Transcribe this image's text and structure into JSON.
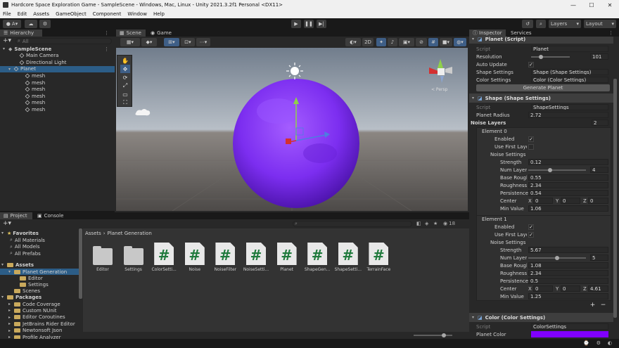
{
  "window": {
    "title": "Hardcore Space Exploration Game - SampleScene - Windows, Mac, Linux - Unity 2021.3.2f1 Personal <DX11>"
  },
  "menu": [
    "File",
    "Edit",
    "Assets",
    "GameObject",
    "Component",
    "Window",
    "Help"
  ],
  "toolbar": {
    "account": "A",
    "layers": "Layers",
    "layout": "Layout"
  },
  "hierarchy": {
    "tab": "Hierarchy",
    "search_placeholder": "All",
    "items": [
      {
        "label": "SampleScene",
        "indent": 0
      },
      {
        "label": "Main Camera",
        "indent": 2
      },
      {
        "label": "Directional Light",
        "indent": 2
      },
      {
        "label": "Planet",
        "indent": 1
      },
      {
        "label": "mesh",
        "indent": 3
      },
      {
        "label": "mesh",
        "indent": 3
      },
      {
        "label": "mesh",
        "indent": 3
      },
      {
        "label": "mesh",
        "indent": 3
      },
      {
        "label": "mesh",
        "indent": 3
      },
      {
        "label": "mesh",
        "indent": 3
      }
    ]
  },
  "scene": {
    "tab_scene": "Scene",
    "tab_game": "Game",
    "mode_2d": "2D",
    "gizmo_label": "< Persp",
    "tool_icons": [
      "hand-icon",
      "move-icon",
      "rotate-icon",
      "scale-icon",
      "rect-icon",
      "transform-icon"
    ]
  },
  "project": {
    "tab_project": "Project",
    "tab_console": "Console",
    "hidden_count": "18",
    "breadcrumb": [
      "Assets",
      "Planet Generation"
    ],
    "favorites_title": "Favorites",
    "favorites": [
      "All Materials",
      "All Models",
      "All Prefabs"
    ],
    "assets_title": "Assets",
    "assets_tree": [
      {
        "label": "Planet Generation",
        "indent": 1
      },
      {
        "label": "Editor",
        "indent": 2
      },
      {
        "label": "Settings",
        "indent": 2
      },
      {
        "label": "Scenes",
        "indent": 1
      }
    ],
    "packages_title": "Packages",
    "packages": [
      "Code Coverage",
      "Custom NUnit",
      "Editor Coroutines",
      "JetBrains Rider Editor",
      "Newtonsoft Json",
      "Profile Analyzer"
    ],
    "files": [
      {
        "name": "Editor",
        "type": "folder"
      },
      {
        "name": "Settings",
        "type": "folder"
      },
      {
        "name": "ColorSetti...",
        "type": "cs"
      },
      {
        "name": "Noise",
        "type": "cs"
      },
      {
        "name": "NoiseFilter",
        "type": "cs"
      },
      {
        "name": "NoiseSetti...",
        "type": "cs"
      },
      {
        "name": "Planet",
        "type": "cs"
      },
      {
        "name": "ShapeGen...",
        "type": "cs"
      },
      {
        "name": "ShapeSetti...",
        "type": "cs"
      },
      {
        "name": "TerrainFace",
        "type": "cs"
      }
    ]
  },
  "inspector": {
    "tab_inspector": "Inspector",
    "tab_services": "Services",
    "planet_script_title": "Planet (Script)",
    "script_label": "Script",
    "script_value": "Planet",
    "resolution_label": "Resolution",
    "resolution_value": "101",
    "resolution_fraction": 0.25,
    "auto_update_label": "Auto Update",
    "shape_settings_label": "Shape Settings",
    "shape_settings_value": "Shape (Shape Settings)",
    "color_settings_label": "Color Settings",
    "color_settings_value": "Color (Color Settings)",
    "generate_button": "Generate Planet",
    "shape_title": "Shape (Shape Settings)",
    "shape_script_value": "ShapeSettings",
    "planet_radius_label": "Planet Radius",
    "planet_radius_value": "2.72",
    "noise_layers_label": "Noise Layers",
    "noise_layers_value": "2",
    "enabled_label": "Enabled",
    "use_first_label": "Use First Layer",
    "noise_settings_label": "Noise Settings",
    "strength_label": "Strength",
    "num_layers_label": "Num Layers",
    "base_rough_label": "Base Roughness",
    "roughness_label": "Roughness",
    "persistence_label": "Persistence",
    "center_label": "Center",
    "min_value_label": "Min Value",
    "x": "X",
    "y": "Y",
    "z": "Z",
    "elements": [
      {
        "title": "Element 0",
        "enabled": true,
        "use_first": false,
        "strength": "0.12",
        "num_layers": "4",
        "num_layers_fraction": 0.38,
        "base_rough": "0.55",
        "roughness": "2.34",
        "persistence": "0.54",
        "cx": "0",
        "cy": "0",
        "cz": "0",
        "min_value": "1.06"
      },
      {
        "title": "Element 1",
        "enabled": true,
        "use_first": true,
        "strength": "5.67",
        "num_layers": "5",
        "num_layers_fraction": 0.5,
        "base_rough": "1.08",
        "roughness": "2.34",
        "persistence": "0.5",
        "cx": "0",
        "cy": "0",
        "cz": "4.61",
        "min_value": "1.25"
      }
    ],
    "color_title": "Color (Color Settings)",
    "color_script_value": "ColorSettings",
    "planet_color_label": "Planet Color",
    "planet_color": "#8000ff"
  },
  "colors": {
    "accent": "#2c5d87",
    "planet": "#8a35f0"
  }
}
